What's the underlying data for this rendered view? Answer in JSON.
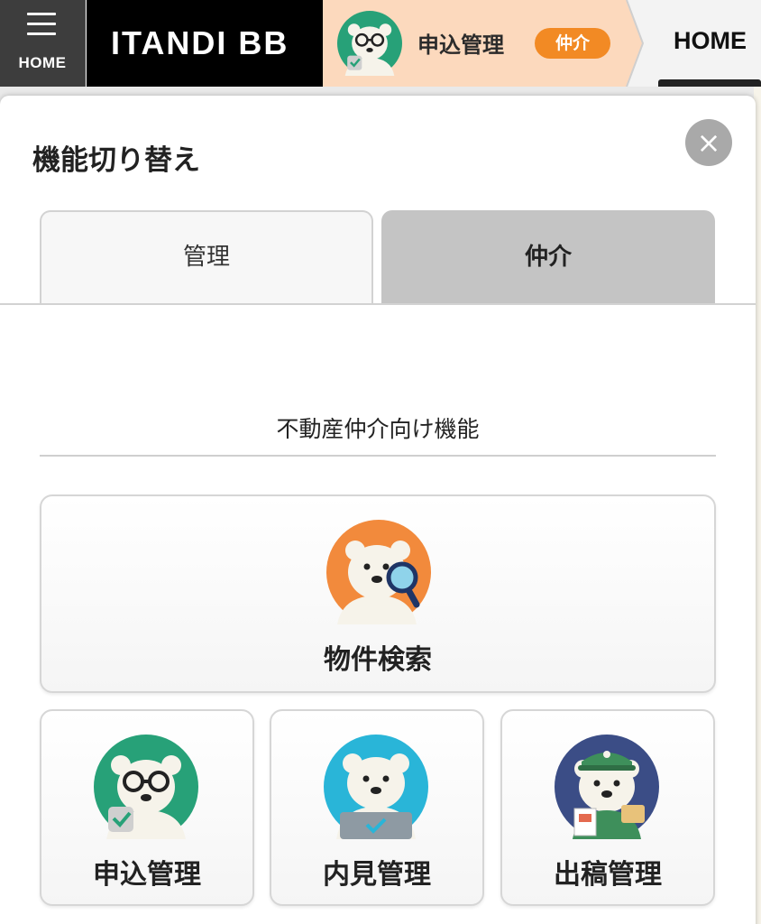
{
  "header": {
    "menu_label": "HOME",
    "brand": "ITANDI BB",
    "breadcrumb": {
      "current_title": "申込管理",
      "current_badge": "仲介",
      "home": "HOME"
    }
  },
  "modal": {
    "title": "機能切り替え",
    "close_symbol": "×",
    "tabs": [
      {
        "label": "管理",
        "active": false
      },
      {
        "label": "仲介",
        "active": true
      }
    ],
    "section_title": "不動産仲介向け機能",
    "features": [
      {
        "label": "物件検索",
        "icon": "bear-magnifier-icon",
        "color": "#f28a3c"
      },
      {
        "label": "申込管理",
        "icon": "bear-glasses-icon",
        "color": "#27a178"
      },
      {
        "label": "内見管理",
        "icon": "bear-laptop-icon",
        "color": "#29b5d8"
      },
      {
        "label": "出稿管理",
        "icon": "bear-postman-icon",
        "color": "#3b4d86"
      }
    ]
  },
  "colors": {
    "accent_orange": "#f28a24",
    "breadcrumb_bg": "#fcd9bd",
    "active_tab": "#c4c4c4"
  }
}
